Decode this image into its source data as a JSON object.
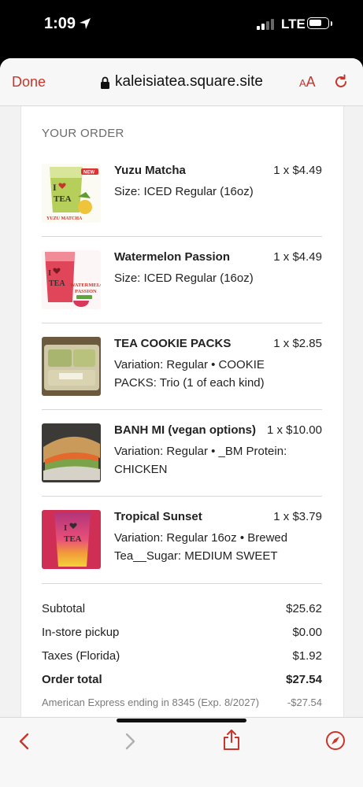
{
  "status": {
    "time": "1:09",
    "network": "LTE"
  },
  "nav": {
    "done_label": "Done",
    "url": "kaleisiatea.square.site",
    "aa_label": "A",
    "aa_small": "A"
  },
  "order": {
    "heading": "YOUR ORDER",
    "items": [
      {
        "name": "Yuzu Matcha",
        "qty": "1 x $4.49",
        "desc": "Size: ICED Regular (16oz)",
        "thumb_caption": "YUZU MATCHA"
      },
      {
        "name": "Watermelon Passion",
        "qty": "1 x $4.49",
        "desc": "Size: ICED Regular (16oz)",
        "thumb_caption": "WATERMELON PASSION"
      },
      {
        "name": "TEA COOKIE PACKS",
        "qty": "1 x $2.85",
        "desc": "Variation: Regular • COOKIE PACKS: Trio (1 of each kind)"
      },
      {
        "name": "BANH MI (vegan options)",
        "qty": "1 x $10.00",
        "desc": "Variation: Regular • _BM Protein: CHICKEN"
      },
      {
        "name": "Tropical Sunset",
        "qty": "1 x $3.79",
        "desc": "Variation: Regular 16oz • Brewed Tea__Sugar: MEDIUM SWEET"
      }
    ],
    "totals": {
      "subtotal_label": "Subtotal",
      "subtotal": "$25.62",
      "pickup_label": "In-store pickup",
      "pickup": "$0.00",
      "tax_label": "Taxes (Florida)",
      "tax": "$1.92",
      "total_label": "Order total",
      "total": "$27.54",
      "payment_label": "American Express ending in 8345 (Exp. 8/2027)",
      "payment": "-$27.54"
    }
  },
  "toolbar": {
    "icons": [
      "back-icon",
      "forward-icon",
      "share-icon",
      "compass-icon"
    ]
  },
  "colors": {
    "accent": "#c9342b",
    "muted": "#6b6b6b"
  }
}
